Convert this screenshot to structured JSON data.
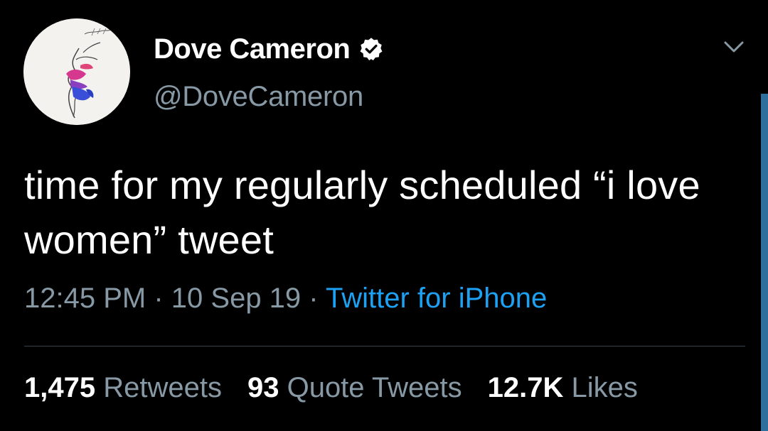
{
  "tweet": {
    "author": {
      "display_name": "Dove Cameron",
      "handle": "@DoveCameron",
      "verified": true
    },
    "text": "time for my regularly scheduled “i love women” tweet",
    "time": "12:45 PM",
    "separator": "·",
    "date": "10 Sep 19",
    "source": "Twitter for iPhone",
    "stats": {
      "retweets_count": "1,475",
      "retweets_label": "Retweets",
      "quote_tweets_count": "93",
      "quote_tweets_label": "Quote Tweets",
      "likes_count": "12.7K",
      "likes_label": "Likes"
    }
  },
  "icons": {
    "verified": "verified-badge-icon",
    "caret": "chevron-down-icon"
  },
  "colors": {
    "background": "#000000",
    "text_primary": "#ffffff",
    "text_secondary": "#8899a6",
    "link": "#1da1f2",
    "divider": "#38444d"
  }
}
